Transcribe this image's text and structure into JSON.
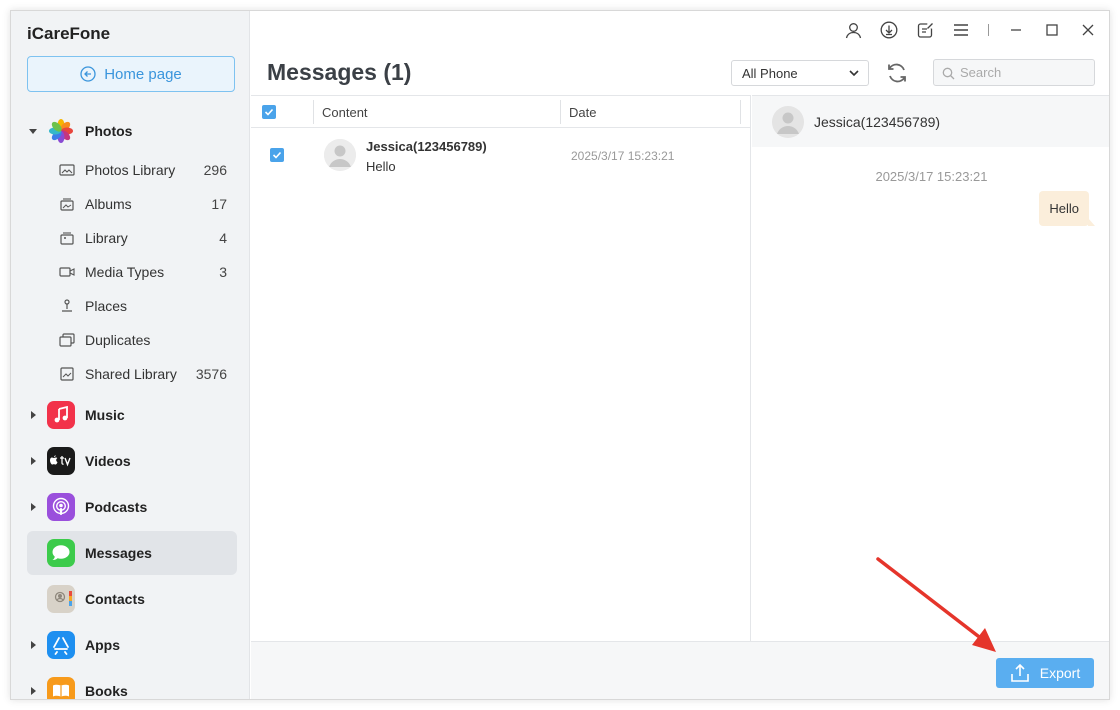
{
  "app": {
    "title": "iCareFone"
  },
  "sidebar": {
    "home_button": "Home page",
    "photos": {
      "label": "Photos",
      "items": [
        {
          "label": "Photos Library",
          "count": "296",
          "icon": "photo-library-icon"
        },
        {
          "label": "Albums",
          "count": "17",
          "icon": "albums-icon"
        },
        {
          "label": "Library",
          "count": "4",
          "icon": "library-icon"
        },
        {
          "label": "Media Types",
          "count": "3",
          "icon": "media-types-icon"
        },
        {
          "label": "Places",
          "count": "",
          "icon": "places-icon"
        },
        {
          "label": "Duplicates",
          "count": "",
          "icon": "duplicates-icon"
        },
        {
          "label": "Shared Library",
          "count": "3576",
          "icon": "shared-library-icon"
        }
      ]
    },
    "categories": [
      {
        "label": "Music",
        "icon": "music-icon",
        "color": "#f2324a"
      },
      {
        "label": "Videos",
        "icon": "tv-icon",
        "color": "#1a1a1a"
      },
      {
        "label": "Podcasts",
        "icon": "podcasts-icon",
        "color": "#9a4fdc"
      },
      {
        "label": "Messages",
        "icon": "messages-icon",
        "color": "#3ccb4b",
        "active": true
      },
      {
        "label": "Contacts",
        "icon": "contacts-icon",
        "color": "#d8d2c8"
      },
      {
        "label": "Apps",
        "icon": "app-store-icon",
        "color": "#1e8ff0"
      },
      {
        "label": "Books",
        "icon": "books-icon",
        "color": "#f79a1b"
      }
    ]
  },
  "header": {
    "title": "Messages (1)",
    "filter_value": "All Phone",
    "search_placeholder": "Search"
  },
  "list": {
    "columns": {
      "content": "Content",
      "date": "Date"
    },
    "rows": [
      {
        "name": "Jessica(123456789)",
        "preview": "Hello",
        "date": "2025/3/17 15:23:21",
        "checked": true
      }
    ]
  },
  "detail": {
    "contact": "Jessica(123456789)",
    "timestamp": "2025/3/17 15:23:21",
    "message": "Hello"
  },
  "footer": {
    "export_label": "Export"
  },
  "colors": {
    "accent": "#5aaef0",
    "bubble": "#fbeedb",
    "arrow": "#e5352b"
  }
}
